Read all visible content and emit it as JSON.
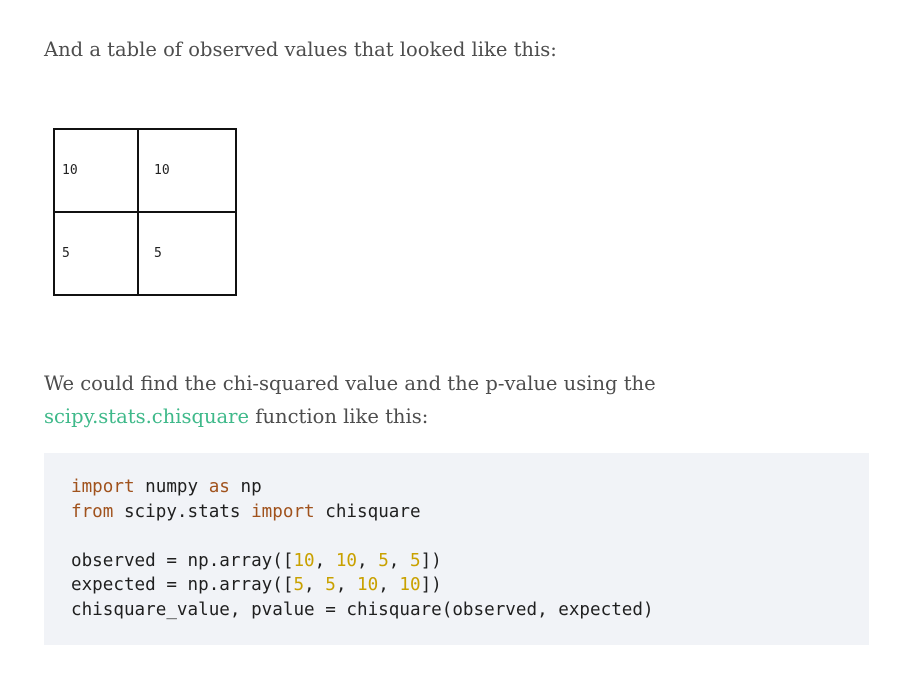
{
  "intro_text": "And a table of observed values that looked like this:",
  "table": {
    "rows": [
      [
        "10",
        "10"
      ],
      [
        "5",
        "5"
      ]
    ]
  },
  "para2": {
    "line1": "We could find the chi-squared value and the p-value using the",
    "link_text": "scipy.stats.chisquare",
    "after_link": " function like this:"
  },
  "code": {
    "line1": {
      "kw1": "import",
      "t1": " numpy ",
      "kw2": "as",
      "t2": " np"
    },
    "line2": {
      "kw1": "from",
      "t1": " scipy.stats ",
      "kw2": "import",
      "t2": " chisquare"
    },
    "line3": {
      "pre": "observed = np.array([",
      "n1": "10",
      "n2": "10",
      "n3": "5",
      "n4": "5",
      "post": "])"
    },
    "line4": {
      "pre": "expected = np.array([",
      "n1": "5",
      "n2": "5",
      "n3": "10",
      "n4": "10",
      "post": "])"
    },
    "line5": "chisquare_value, pvalue = chisquare(observed, expected)"
  },
  "colors": {
    "link": "#3fb98a",
    "keyword": "#a0521d",
    "number": "#c9a100",
    "code_bg": "#f1f3f7"
  }
}
